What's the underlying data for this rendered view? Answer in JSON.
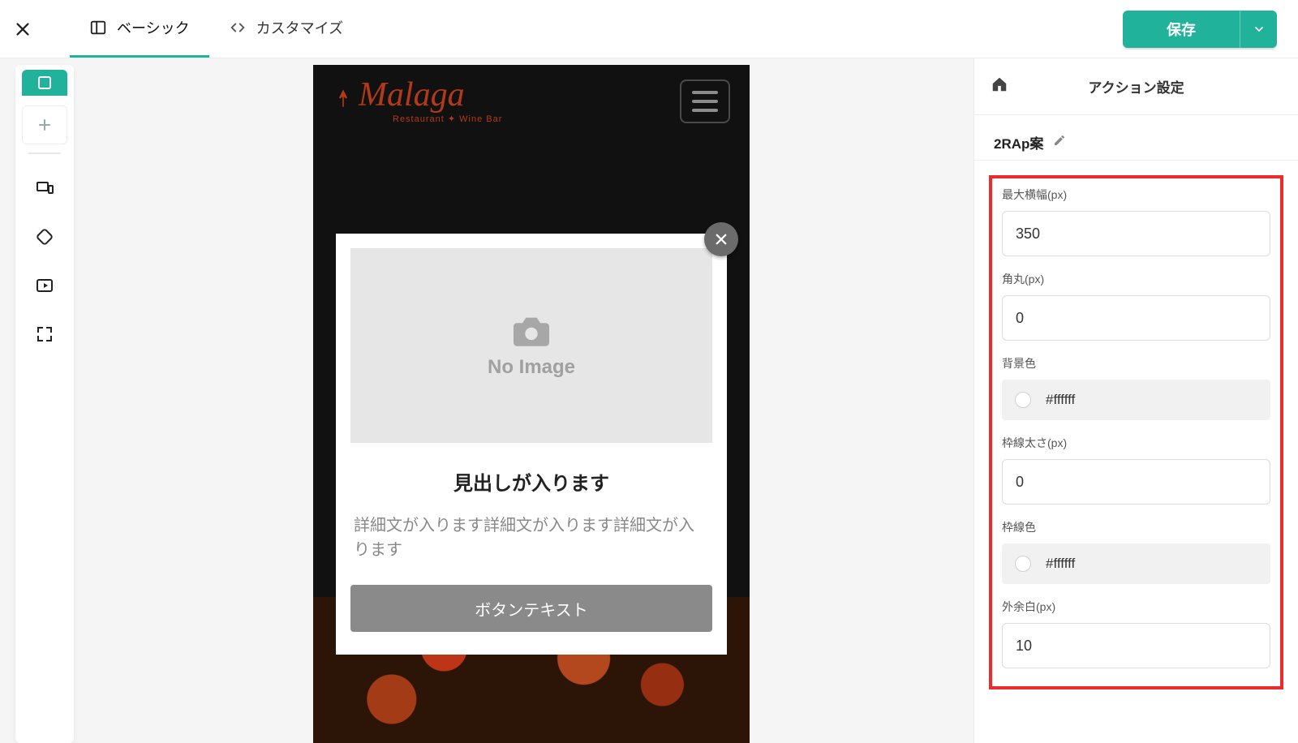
{
  "topbar": {
    "tabs": {
      "basic": "ベーシック",
      "customize": "カスタマイズ"
    },
    "save": "保存"
  },
  "preview": {
    "brand": {
      "name": "Malaga",
      "sub": "Restaurant ✦ Wine Bar"
    },
    "noimage": "No Image",
    "heading": "見出しが入ります",
    "desc": "詳細文が入ります詳細文が入ります詳細文が入ります",
    "button": "ボタンテキスト"
  },
  "panel": {
    "title": "アクション設定",
    "name": "2RAp案",
    "fields": {
      "max_width": {
        "label": "最大横幅(px)",
        "value": "350"
      },
      "radius": {
        "label": "角丸(px)",
        "value": "0"
      },
      "bgcolor": {
        "label": "背景色",
        "value": "#ffffff"
      },
      "border_w": {
        "label": "枠線太さ(px)",
        "value": "0"
      },
      "border_c": {
        "label": "枠線色",
        "value": "#ffffff"
      },
      "margin": {
        "label": "外余白(px)",
        "value": "10"
      }
    }
  }
}
